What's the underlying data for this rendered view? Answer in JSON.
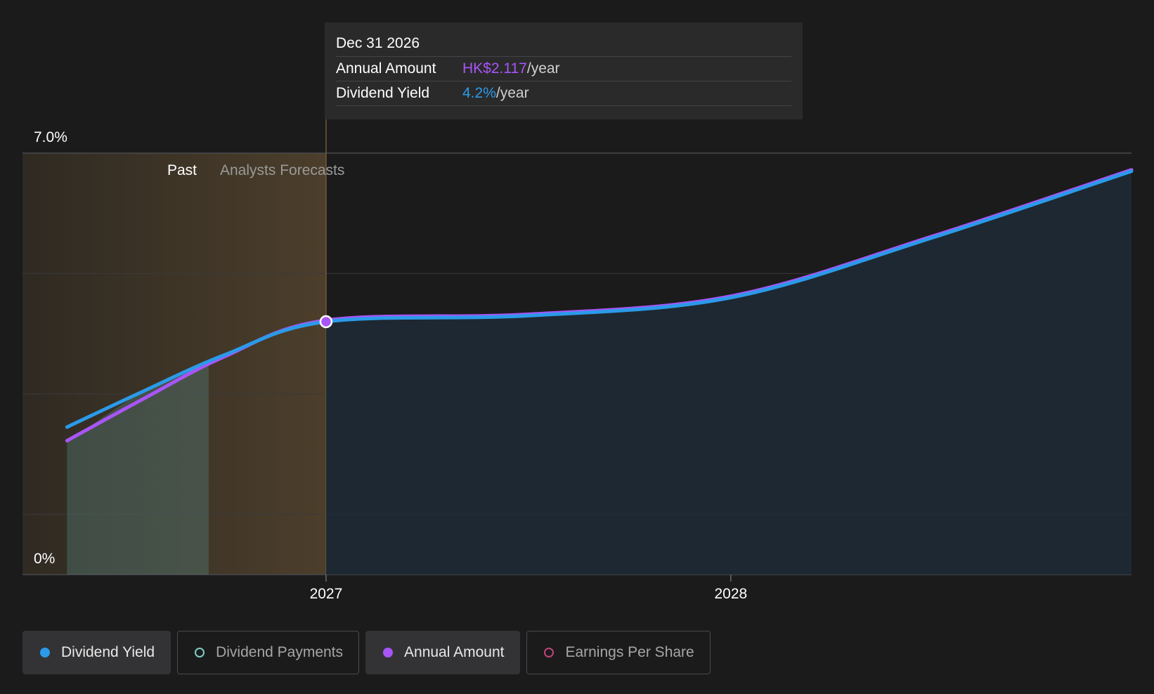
{
  "chart_data": {
    "type": "area",
    "y_tick_labels": [
      "7.0%",
      "0%"
    ],
    "ylim": [
      0,
      7.0
    ],
    "x_tick_labels": [
      "2027",
      "2028"
    ],
    "x_ticks": [
      2027.0,
      2028.0
    ],
    "xlim": [
      2026.25,
      2028.99
    ],
    "region_labels": {
      "past": "Past",
      "forecast": "Analysts Forecasts"
    },
    "forecast_start": 2027.0,
    "grid": true,
    "series": [
      {
        "name": "Dividend Yield",
        "color": "#2b9ae8",
        "x": [
          2026.36,
          2026.55,
          2026.75,
          2027.0,
          2027.5,
          2028.0,
          2028.5,
          2028.99
        ],
        "values": [
          2.45,
          3.05,
          3.65,
          4.2,
          4.3,
          4.6,
          5.6,
          6.7
        ]
      },
      {
        "name": "Annual Amount",
        "color": "#a855f7",
        "x": [
          2026.36,
          2026.55,
          2026.75,
          2027.0,
          2027.5,
          2028.0,
          2028.5,
          2028.99
        ],
        "values": [
          2.2,
          2.9,
          3.6,
          4.2,
          4.3,
          4.6,
          5.6,
          6.7
        ]
      },
      {
        "name": "Dividend Payments",
        "color": "#7ecec4",
        "x": [
          2026.36,
          2026.55,
          2026.71
        ],
        "values": [
          2.2,
          3.05,
          3.5
        ]
      }
    ],
    "tooltip": {
      "date": "Dec 31 2026",
      "x": 2027.0,
      "annual_amount_label": "Annual Amount",
      "annual_amount_value": "HK$2.117",
      "dividend_yield_label": "Dividend Yield",
      "dividend_yield_value": "4.2%",
      "per_year": "/year"
    },
    "legend": [
      {
        "label": "Dividend Yield",
        "color": "#2b9ae8",
        "filled": true,
        "active": true
      },
      {
        "label": "Dividend Payments",
        "color": "#7ecec4",
        "filled": false,
        "active": false
      },
      {
        "label": "Annual Amount",
        "color": "#a855f7",
        "filled": true,
        "active": true
      },
      {
        "label": "Earnings Per Share",
        "color": "#c0447a",
        "filled": false,
        "active": false
      }
    ]
  }
}
